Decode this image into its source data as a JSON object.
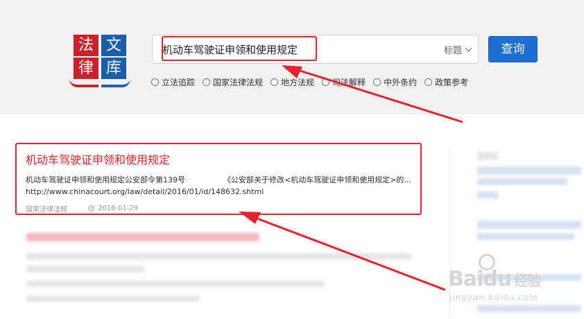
{
  "logo": {
    "chars": [
      "法",
      "文",
      "律",
      "库"
    ]
  },
  "search": {
    "value": "机动车驾驶证申领和使用规定",
    "field_selected": "标题",
    "button_label": "查询"
  },
  "categories": [
    "立法追踪",
    "国家法律法规",
    "地方法规",
    "司法解释",
    "中外条约",
    "政策参考"
  ],
  "result": {
    "title": "机动车驾驶证申领和使用规定",
    "snippet_left": "机动车驾驶证申领和使用规定公安部令第139号",
    "snippet_right": "《公安部关于修改<机动车驾驶证申领和使用规定>的...",
    "url": "http://www.chinacourt.org/law/detail/2016/01/id/148632.shtml",
    "source": "国家法律法规",
    "date": "2016-01-29"
  },
  "watermark": {
    "brand": "Bai",
    "brand_suffix": "du",
    "brand_cn": "经验",
    "site": "jingyan.baidu.com"
  },
  "colors": {
    "accent_red": "#d8232a",
    "query_blue": "#1d6fd2",
    "logo_red": "#c8232c",
    "logo_blue": "#1b5fa8",
    "annotation": "#e8222a"
  }
}
